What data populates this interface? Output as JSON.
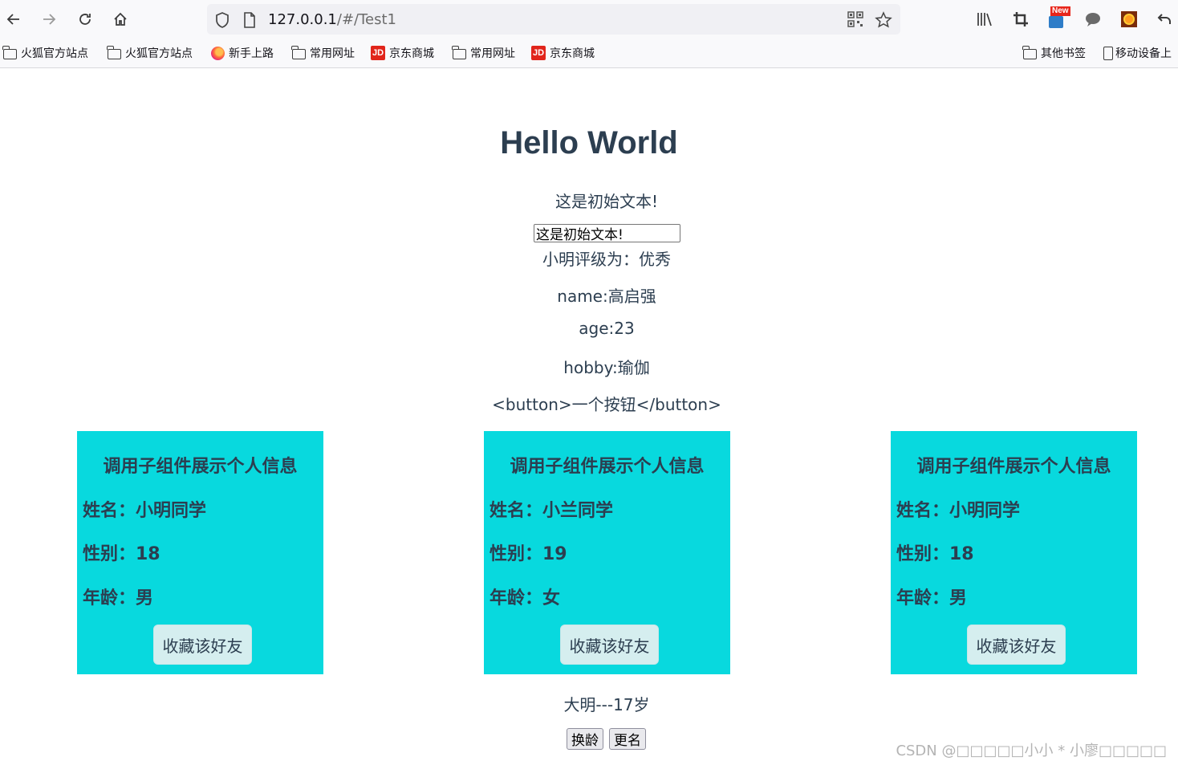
{
  "browser": {
    "url_host": "127.0.0.1",
    "url_path": "/#/Test1",
    "new_badge": "New",
    "bookmarks": [
      {
        "label": "火狐官方站点",
        "icon": "folder-icon"
      },
      {
        "label": "火狐官方站点",
        "icon": "folder-icon"
      },
      {
        "label": "新手上路",
        "icon": "firefox-icon"
      },
      {
        "label": "常用网址",
        "icon": "folder-icon"
      },
      {
        "label": "京东商城",
        "icon": "jd-icon"
      },
      {
        "label": "常用网址",
        "icon": "folder-icon"
      },
      {
        "label": "京东商城",
        "icon": "jd-icon"
      }
    ],
    "bookmarks_right": [
      {
        "label": "其他书签",
        "icon": "folder-icon"
      },
      {
        "label": "移动设备上",
        "icon": "phone-icon"
      }
    ],
    "jd_logo_text": "JD"
  },
  "page": {
    "title": "Hello World",
    "initial_text": "这是初始文本!",
    "input_value": "这是初始文本!",
    "rating": "小明评级为：优秀",
    "name_line": "name:高启强",
    "age_line": "age:23",
    "hobby_line": "hobby:瑜伽",
    "raw_html_line": "<button>一个按钮</button>",
    "cards": [
      {
        "title": "调用子组件展示个人信息",
        "name": "姓名：小明同学",
        "gender": "性别：18",
        "age": "年龄：男",
        "button": "收藏该好友"
      },
      {
        "title": "调用子组件展示个人信息",
        "name": "姓名：小兰同学",
        "gender": "性别：19",
        "age": "年龄：女",
        "button": "收藏该好友"
      },
      {
        "title": "调用子组件展示个人信息",
        "name": "姓名：小明同学",
        "gender": "性别：18",
        "age": "年龄：男",
        "button": "收藏该好友"
      }
    ],
    "person_line": "大明---17岁",
    "change_age_button": "换龄",
    "rename_button": "更名",
    "watermark": "CSDN @□□□□□小小 * 小廖□□□□□"
  },
  "colors": {
    "card_bg": "#08d9de",
    "text": "#2c3e50"
  }
}
